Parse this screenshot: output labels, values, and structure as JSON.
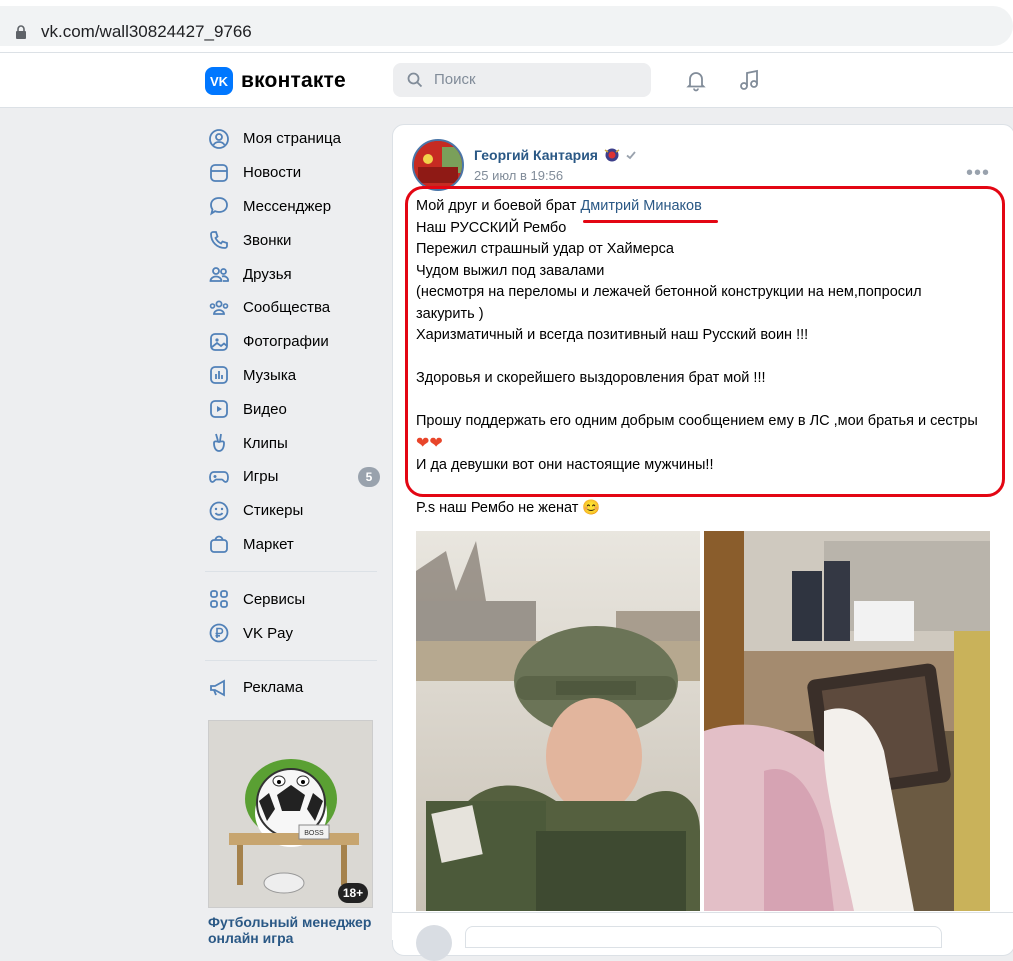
{
  "browser": {
    "url": "vk.com/wall30824427_9766"
  },
  "header": {
    "logo_text": "вконтакте",
    "logo_mark": "VK",
    "search_placeholder": "Поиск",
    "icons": [
      "bell-icon",
      "music-icon"
    ]
  },
  "sidebar": {
    "items": [
      {
        "label": "Моя страница",
        "icon": "user-circle-icon"
      },
      {
        "label": "Новости",
        "icon": "news-icon"
      },
      {
        "label": "Мессенджер",
        "icon": "chat-icon"
      },
      {
        "label": "Звонки",
        "icon": "phone-icon"
      },
      {
        "label": "Друзья",
        "icon": "friends-icon"
      },
      {
        "label": "Сообщества",
        "icon": "communities-icon"
      },
      {
        "label": "Фотографии",
        "icon": "photo-icon"
      },
      {
        "label": "Музыка",
        "icon": "music-icon"
      },
      {
        "label": "Видео",
        "icon": "video-icon"
      },
      {
        "label": "Клипы",
        "icon": "clips-icon"
      },
      {
        "label": "Игры",
        "icon": "gamepad-icon",
        "badge": "5"
      },
      {
        "label": "Стикеры",
        "icon": "smile-icon"
      },
      {
        "label": "Маркет",
        "icon": "bag-icon"
      }
    ],
    "extra": [
      {
        "label": "Сервисы",
        "icon": "grid-icon"
      },
      {
        "label": "VK Pay",
        "icon": "ruble-icon"
      }
    ],
    "ads": {
      "label": "Реклама",
      "icon": "megaphone-icon"
    },
    "promo": {
      "title": "Футбольный менеджер онлайн игра",
      "age": "18+",
      "sign": "BOSS"
    }
  },
  "post": {
    "author": "Георгий Кантария",
    "date": "25 июл в 19:56",
    "more": "•••",
    "line1_prefix": "Мой друг и боевой брат ",
    "mention": "Дмитрий Минаков",
    "lines": [
      "Наш РУССКИЙ Рембо",
      "Пережил страшный удар от Хаймерса",
      "Чудом выжил под завалами",
      "(несмотря на переломы и лежачей бетонной конструкции на нем,попросил",
      "закурить )",
      "Харизматичный и всегда позитивный наш Русский воин !!!"
    ],
    "line_health": "Здоровья и скорейшего выздоровления брат мой !!!",
    "line_support": "Прошу поддержать его одним добрым сообщением ему в ЛС ,мои братья и сестры",
    "hearts": "❤❤",
    "line_girls": "И да девушки вот они настоящие мужчины!!",
    "ps": "P.s наш Рембо не женат 😊"
  }
}
